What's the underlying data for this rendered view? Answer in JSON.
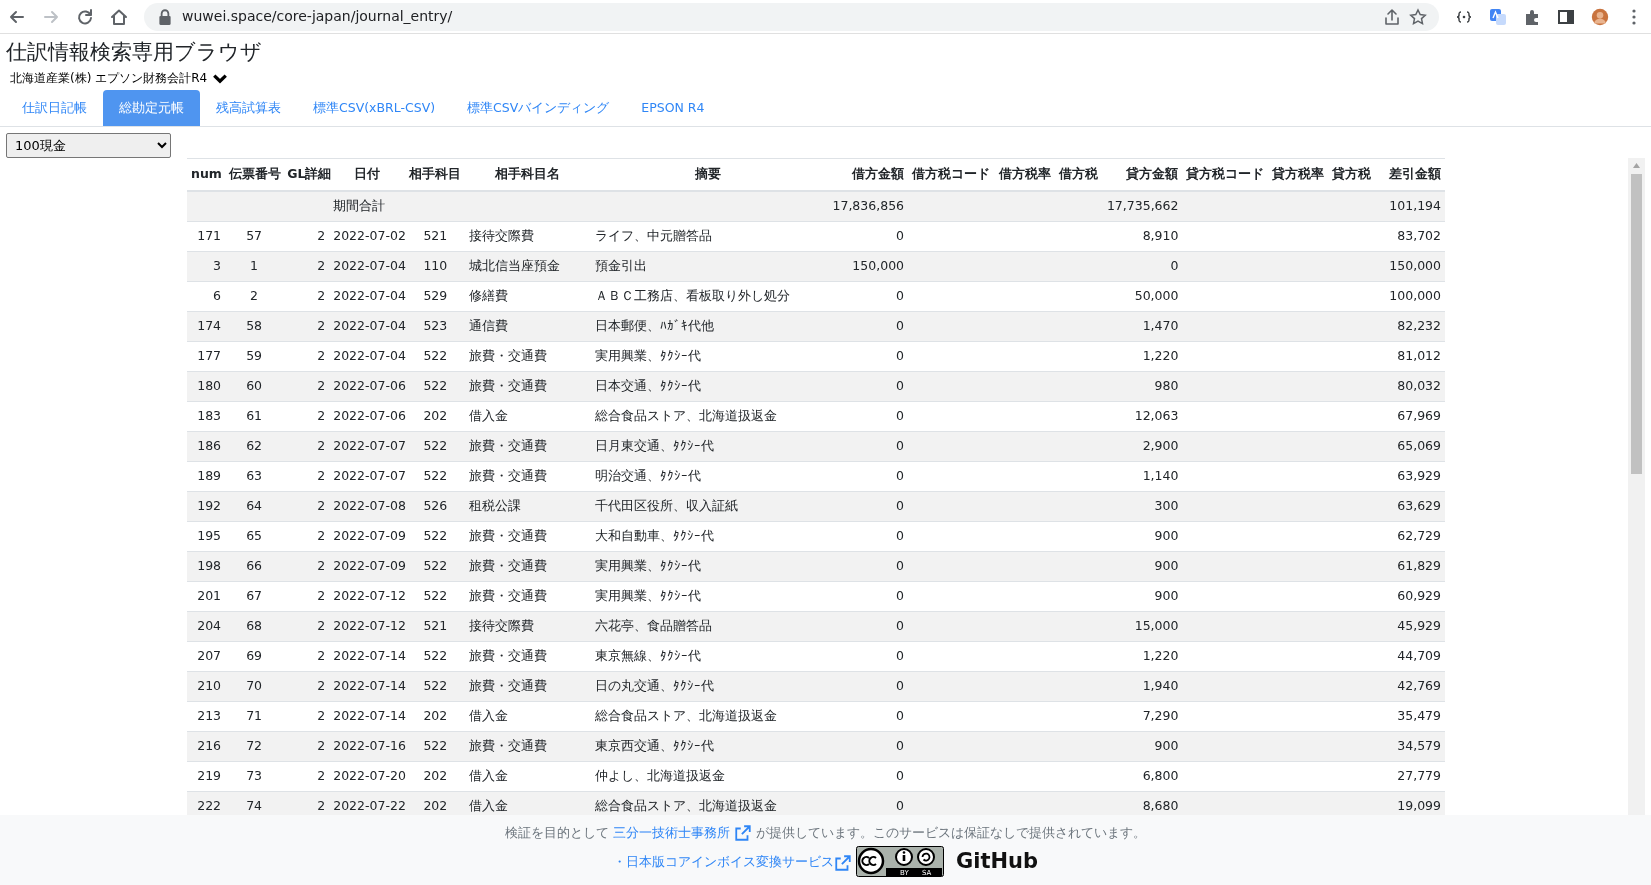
{
  "browser": {
    "url": "wuwei.space/core-japan/journal_entry/"
  },
  "page_title": "仕訳情報検索専用ブラウザ",
  "company": {
    "label": "北海道産業(株) エプソン財務会計R4"
  },
  "tabs": [
    {
      "label": "仕訳日記帳",
      "selected": false
    },
    {
      "label": "総勘定元帳",
      "selected": true
    },
    {
      "label": "残高試算表",
      "selected": false
    },
    {
      "label": "標準CSV(xBRL-CSV)",
      "selected": false
    },
    {
      "label": "標準CSVバインディング",
      "selected": false
    },
    {
      "label": "EPSON R4",
      "selected": false
    }
  ],
  "account_select": {
    "value": "100現金"
  },
  "table": {
    "columns": [
      "num",
      "伝票番号",
      "GL詳細",
      "日付",
      "相手科目",
      "相手科目名",
      "摘要",
      "借方金額",
      "借方税コード",
      "借方税率",
      "借方税",
      "貸方金額",
      "貸方税コード",
      "貸方税率",
      "貸方税",
      "差引金額"
    ],
    "rows": [
      {
        "kind": "total",
        "date": "期間合計",
        "debit": "17,836,856",
        "credit": "17,735,662",
        "balance": "101,194"
      },
      {
        "kind": "entry",
        "num": "171",
        "slip": "57",
        "gl": "2",
        "date": "2022-07-02",
        "code": "521",
        "name": "接待交際費",
        "memo": "ライフ、中元贈答品",
        "debit": "0",
        "credit": "8,910",
        "balance": "83,702"
      },
      {
        "kind": "entry",
        "num": "3",
        "slip": "1",
        "gl": "2",
        "date": "2022-07-04",
        "code": "110",
        "name": "城北信当座預金",
        "memo": "預金引出",
        "debit": "150,000",
        "credit": "0",
        "balance": "150,000"
      },
      {
        "kind": "entry",
        "num": "6",
        "slip": "2",
        "gl": "2",
        "date": "2022-07-04",
        "code": "529",
        "name": "修繕費",
        "memo": "ＡＢＣ工務店、看板取り外し処分",
        "debit": "0",
        "credit": "50,000",
        "balance": "100,000"
      },
      {
        "kind": "entry",
        "num": "174",
        "slip": "58",
        "gl": "2",
        "date": "2022-07-04",
        "code": "523",
        "name": "通信費",
        "memo": "日本郵便、ﾊｶﾞｷ代他",
        "debit": "0",
        "credit": "1,470",
        "balance": "82,232"
      },
      {
        "kind": "entry",
        "num": "177",
        "slip": "59",
        "gl": "2",
        "date": "2022-07-04",
        "code": "522",
        "name": "旅費・交通費",
        "memo": "実用興業、ﾀｸｼｰ代",
        "debit": "0",
        "credit": "1,220",
        "balance": "81,012"
      },
      {
        "kind": "entry",
        "num": "180",
        "slip": "60",
        "gl": "2",
        "date": "2022-07-06",
        "code": "522",
        "name": "旅費・交通費",
        "memo": "日本交通、ﾀｸｼｰ代",
        "debit": "0",
        "credit": "980",
        "balance": "80,032"
      },
      {
        "kind": "entry",
        "num": "183",
        "slip": "61",
        "gl": "2",
        "date": "2022-07-06",
        "code": "202",
        "name": "借入金",
        "memo": "総合食品ストア、北海道扱返金",
        "debit": "0",
        "credit": "12,063",
        "balance": "67,969"
      },
      {
        "kind": "entry",
        "num": "186",
        "slip": "62",
        "gl": "2",
        "date": "2022-07-07",
        "code": "522",
        "name": "旅費・交通費",
        "memo": "日月東交通、ﾀｸｼｰ代",
        "debit": "0",
        "credit": "2,900",
        "balance": "65,069"
      },
      {
        "kind": "entry",
        "num": "189",
        "slip": "63",
        "gl": "2",
        "date": "2022-07-07",
        "code": "522",
        "name": "旅費・交通費",
        "memo": "明治交通、ﾀｸｼｰ代",
        "debit": "0",
        "credit": "1,140",
        "balance": "63,929"
      },
      {
        "kind": "entry",
        "num": "192",
        "slip": "64",
        "gl": "2",
        "date": "2022-07-08",
        "code": "526",
        "name": "租税公課",
        "memo": "千代田区役所、収入証紙",
        "debit": "0",
        "credit": "300",
        "balance": "63,629"
      },
      {
        "kind": "entry",
        "num": "195",
        "slip": "65",
        "gl": "2",
        "date": "2022-07-09",
        "code": "522",
        "name": "旅費・交通費",
        "memo": "大和自動車、ﾀｸｼｰ代",
        "debit": "0",
        "credit": "900",
        "balance": "62,729"
      },
      {
        "kind": "entry",
        "num": "198",
        "slip": "66",
        "gl": "2",
        "date": "2022-07-09",
        "code": "522",
        "name": "旅費・交通費",
        "memo": "実用興業、ﾀｸｼｰ代",
        "debit": "0",
        "credit": "900",
        "balance": "61,829"
      },
      {
        "kind": "entry",
        "num": "201",
        "slip": "67",
        "gl": "2",
        "date": "2022-07-12",
        "code": "522",
        "name": "旅費・交通費",
        "memo": "実用興業、ﾀｸｼｰ代",
        "debit": "0",
        "credit": "900",
        "balance": "60,929"
      },
      {
        "kind": "entry",
        "num": "204",
        "slip": "68",
        "gl": "2",
        "date": "2022-07-12",
        "code": "521",
        "name": "接待交際費",
        "memo": "六花亭、食品贈答品",
        "debit": "0",
        "credit": "15,000",
        "balance": "45,929"
      },
      {
        "kind": "entry",
        "num": "207",
        "slip": "69",
        "gl": "2",
        "date": "2022-07-14",
        "code": "522",
        "name": "旅費・交通費",
        "memo": "東京無線、ﾀｸｼｰ代",
        "debit": "0",
        "credit": "1,220",
        "balance": "44,709"
      },
      {
        "kind": "entry",
        "num": "210",
        "slip": "70",
        "gl": "2",
        "date": "2022-07-14",
        "code": "522",
        "name": "旅費・交通費",
        "memo": "日の丸交通、ﾀｸｼｰ代",
        "debit": "0",
        "credit": "1,940",
        "balance": "42,769"
      },
      {
        "kind": "entry",
        "num": "213",
        "slip": "71",
        "gl": "2",
        "date": "2022-07-14",
        "code": "202",
        "name": "借入金",
        "memo": "総合食品ストア、北海道扱返金",
        "debit": "0",
        "credit": "7,290",
        "balance": "35,479"
      },
      {
        "kind": "entry",
        "num": "216",
        "slip": "72",
        "gl": "2",
        "date": "2022-07-16",
        "code": "522",
        "name": "旅費・交通費",
        "memo": "東京西交通、ﾀｸｼｰ代",
        "debit": "0",
        "credit": "900",
        "balance": "34,579"
      },
      {
        "kind": "entry",
        "num": "219",
        "slip": "73",
        "gl": "2",
        "date": "2022-07-20",
        "code": "202",
        "name": "借入金",
        "memo": "仲よし、北海道扱返金",
        "debit": "0",
        "credit": "6,800",
        "balance": "27,779"
      },
      {
        "kind": "entry",
        "num": "222",
        "slip": "74",
        "gl": "2",
        "date": "2022-07-22",
        "code": "202",
        "name": "借入金",
        "memo": "総合食品ストア、北海道扱返金",
        "debit": "0",
        "credit": "8,680",
        "balance": "19,099"
      }
    ]
  },
  "footer": {
    "before": "検証を目的として",
    "link": "三分一技術士事務所",
    "after": "が提供しています。このサービスは保証なしで提供されています。",
    "service_link": "・日本版コアインボイス変換サービス",
    "license_by": "BY",
    "license_sa": "SA",
    "github": "GitHub"
  }
}
